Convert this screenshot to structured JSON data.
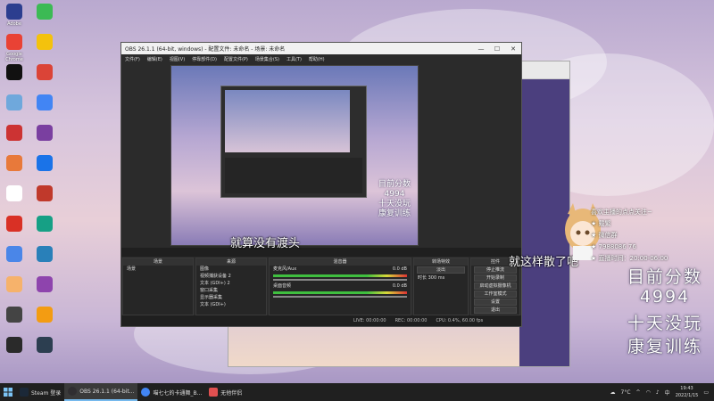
{
  "desktop_icons": [
    {
      "label": "Adobe",
      "color": "#2c3e8f"
    },
    {
      "label": "Google Chrome",
      "color": "#e94235"
    },
    {
      "label": "",
      "color": "#111111"
    },
    {
      "label": "",
      "color": "#6fa8dc"
    },
    {
      "label": "",
      "color": "#cc3333"
    },
    {
      "label": "",
      "color": "#e8793a"
    },
    {
      "label": "",
      "color": "#ffffff"
    },
    {
      "label": "",
      "color": "#d93025"
    },
    {
      "label": "",
      "color": "#4a86e8"
    },
    {
      "label": "",
      "color": "#f6b26b"
    },
    {
      "label": "",
      "color": "#444444"
    },
    {
      "label": "",
      "color": "#2a2a2a"
    },
    {
      "label": "",
      "color": "#3cba54"
    },
    {
      "label": "",
      "color": "#f4c20d"
    },
    {
      "label": "",
      "color": "#db4437"
    },
    {
      "label": "",
      "color": "#4285f4"
    },
    {
      "label": "",
      "color": "#7a3fa0"
    },
    {
      "label": "",
      "color": "#1a73e8"
    },
    {
      "label": "",
      "color": "#c0392b"
    },
    {
      "label": "",
      "color": "#16a085"
    },
    {
      "label": "",
      "color": "#2980b9"
    },
    {
      "label": "",
      "color": "#8e44ad"
    },
    {
      "label": "",
      "color": "#f39c12"
    },
    {
      "label": "",
      "color": "#2c3e50"
    }
  ],
  "obs": {
    "title": "OBS 26.1.1 (64-bit, windows) - 配置文件: 未命名 - 场景: 未命名",
    "menu": [
      "文件(F)",
      "编辑(E)",
      "视图(V)",
      "停靠部件(D)",
      "配置文件(P)",
      "场景集合(S)",
      "工具(T)",
      "帮助(H)"
    ],
    "preview_text": [
      "目前分数",
      "4994",
      "十天没玩",
      "康复训练"
    ],
    "dock_titles": [
      "场景",
      "来源",
      "混音器",
      "转场特效",
      "控件"
    ],
    "scenes": [
      "场景"
    ],
    "sources": [
      "图像",
      "视频捕获设备 2",
      "文本 (GDI+) 2",
      "窗口采集",
      "显示器采集",
      "文本 (GDI+)"
    ],
    "mixer": [
      {
        "label": "麦克风/Aux",
        "level": "0.0 dB"
      },
      {
        "label": "桌面音频",
        "level": "0.0 dB"
      }
    ],
    "transition": {
      "value": "淡出",
      "duration_label": "时长",
      "duration": "300 ms"
    },
    "controls": [
      "停止推流",
      "开始录制",
      "启动虚拟摄像机",
      "工作室模式",
      "设置",
      "退出"
    ],
    "status": {
      "live": "LIVE: 00:00:00",
      "rec": "REC: 00:00:00",
      "cpu": "CPU: 0.4%, 60.00 fps"
    }
  },
  "subtitles": {
    "left": "就算没有渡头",
    "right": "就这样散了吧"
  },
  "overlay": {
    "lines": [
      "喜欢主播的点点关注~",
      "★ 戴繁",
      "★ 微信群",
      "★ 7988086 76",
      "★ 直播时间：20:00-06:00"
    ],
    "big": [
      "目前分数",
      "4994",
      "十天没玩",
      "康复训练"
    ]
  },
  "taskbar": {
    "items": [
      {
        "label": "Steam 登录",
        "color": "#1b2838"
      },
      {
        "label": "OBS 26.1.1 (64-bit...",
        "color": "#302e31"
      },
      {
        "label": "喵七七的卡通舞_B...",
        "color": "#4285f4"
      },
      {
        "label": "无他伴侣",
        "color": "#e05050"
      }
    ],
    "weather": "7°C",
    "time": "19:43",
    "date": "2022/1/15"
  }
}
